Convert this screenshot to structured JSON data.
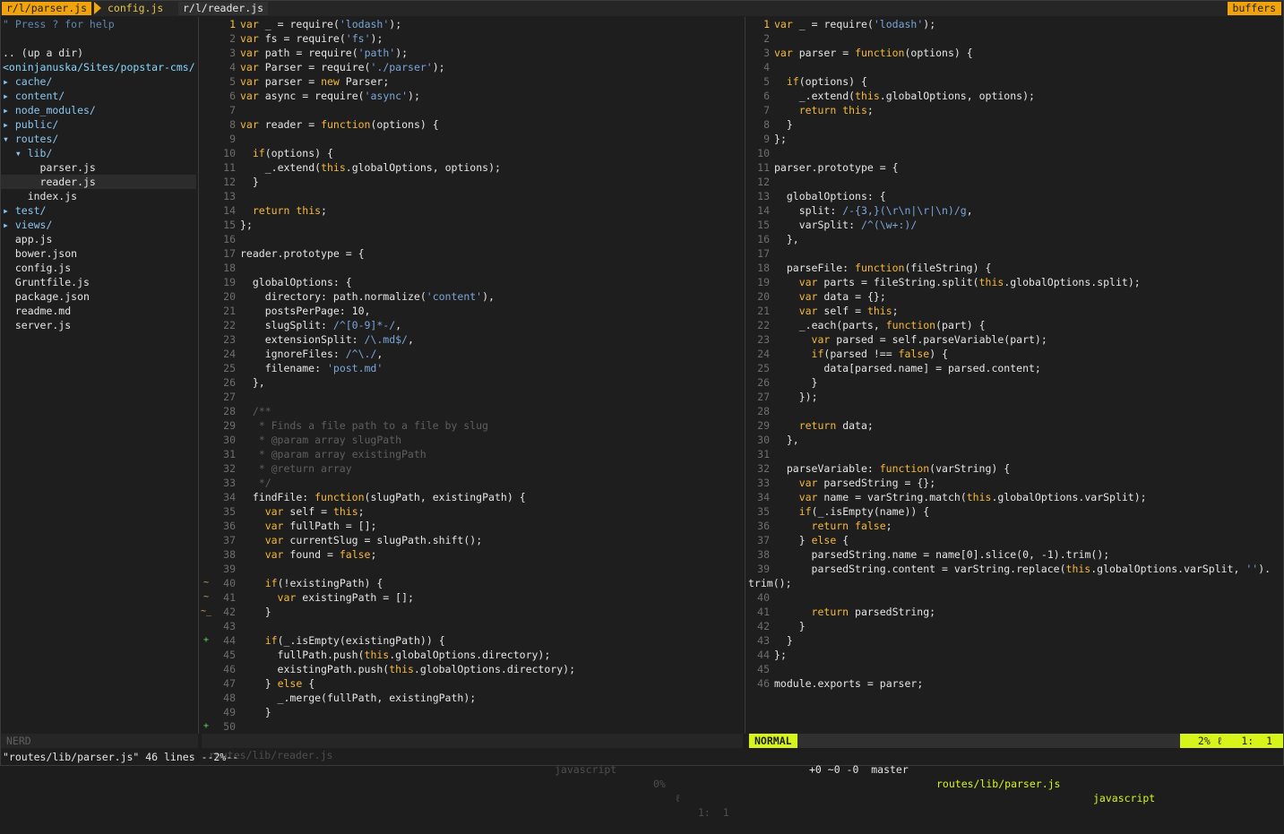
{
  "tabline": {
    "tabs": [
      "r/l/parser.js",
      "config.js",
      "r/l/reader.js"
    ],
    "buffers_label": "buffers"
  },
  "tree": {
    "lines": [
      {
        "text": "\" Press ? for help",
        "kind": "comment"
      },
      {
        "text": "",
        "kind": "blank"
      },
      {
        "text": ".. (up a dir)",
        "kind": "file"
      },
      {
        "text": "<oninjanuska/Sites/popstar-cms/",
        "kind": "root"
      },
      {
        "text": "▸ cache/",
        "kind": "dir"
      },
      {
        "text": "▸ content/",
        "kind": "dir"
      },
      {
        "text": "▸ node_modules/",
        "kind": "dir"
      },
      {
        "text": "▸ public/",
        "kind": "dir"
      },
      {
        "text": "▾ routes/",
        "kind": "dir"
      },
      {
        "text": "  ▾ lib/",
        "kind": "dir"
      },
      {
        "text": "      parser.js",
        "kind": "file"
      },
      {
        "text": "      reader.js",
        "kind": "file-hi"
      },
      {
        "text": "    index.js",
        "kind": "file"
      },
      {
        "text": "▸ test/",
        "kind": "dir"
      },
      {
        "text": "▸ views/",
        "kind": "dir"
      },
      {
        "text": "  app.js",
        "kind": "file"
      },
      {
        "text": "  bower.json",
        "kind": "file"
      },
      {
        "text": "  config.js",
        "kind": "file"
      },
      {
        "text": "  Gruntfile.js",
        "kind": "file"
      },
      {
        "text": "  package.json",
        "kind": "file"
      },
      {
        "text": "  readme.md",
        "kind": "file"
      },
      {
        "text": "  server.js",
        "kind": "file"
      }
    ]
  },
  "git_gutter": [
    {
      "line": 40,
      "mark": "~"
    },
    {
      "line": 41,
      "mark": "~"
    },
    {
      "line": 42,
      "mark": "~_"
    },
    {
      "line": 44,
      "mark": "+"
    },
    {
      "line": 50,
      "mark": "+"
    }
  ],
  "editor_left": {
    "lines": [
      "var _ = require('lodash');",
      "var fs = require('fs');",
      "var path = require('path');",
      "var Parser = require('./parser');",
      "var parser = new Parser;",
      "var async = require('async');",
      "",
      "var reader = function(options) {",
      "",
      "  if(options) {",
      "    _.extend(this.globalOptions, options);",
      "  }",
      "",
      "  return this;",
      "};",
      "",
      "reader.prototype = {",
      "",
      "  globalOptions: {",
      "    directory: path.normalize('content'),",
      "    postsPerPage: 10,",
      "    slugSplit: /^[0-9]*-/,",
      "    extensionSplit: /\\.md$/,",
      "    ignoreFiles: /^\\./,",
      "    filename: 'post.md'",
      "  },",
      "",
      "  /**",
      "   * Finds a file path to a file by slug",
      "   * @param array slugPath",
      "   * @param array existingPath",
      "   * @return array",
      "   */",
      "  findFile: function(slugPath, existingPath) {",
      "    var self = this;",
      "    var fullPath = [];",
      "    var currentSlug = slugPath.shift();",
      "    var found = false;",
      "",
      "    if(!existingPath) {",
      "      var existingPath = [];",
      "    }",
      "",
      "    if(_.isEmpty(existingPath)) {",
      "      fullPath.push(this.globalOptions.directory);",
      "      existingPath.push(this.globalOptions.directory);",
      "    } else {",
      "      _.merge(fullPath, existingPath);",
      "    }",
      ""
    ]
  },
  "editor_right": {
    "lines": [
      {
        "n": "1",
        "t": "var _ = require('lodash');"
      },
      {
        "n": "2",
        "t": ""
      },
      {
        "n": "3",
        "t": "var parser = function(options) {"
      },
      {
        "n": "4",
        "t": ""
      },
      {
        "n": "5",
        "t": "  if(options) {"
      },
      {
        "n": "6",
        "t": "    _.extend(this.globalOptions, options);"
      },
      {
        "n": "7",
        "t": "    return this;"
      },
      {
        "n": "8",
        "t": "  }"
      },
      {
        "n": "9",
        "t": "};"
      },
      {
        "n": "10",
        "t": ""
      },
      {
        "n": "11",
        "t": "parser.prototype = {"
      },
      {
        "n": "12",
        "t": ""
      },
      {
        "n": "13",
        "t": "  globalOptions: {"
      },
      {
        "n": "14",
        "t": "    split: /-{3,}(\\r\\n|\\r|\\n)/g,"
      },
      {
        "n": "15",
        "t": "    varSplit: /^(\\w+:)/"
      },
      {
        "n": "16",
        "t": "  },"
      },
      {
        "n": "17",
        "t": ""
      },
      {
        "n": "18",
        "t": "  parseFile: function(fileString) {"
      },
      {
        "n": "19",
        "t": "    var parts = fileString.split(this.globalOptions.split);"
      },
      {
        "n": "20",
        "t": "    var data = {};"
      },
      {
        "n": "21",
        "t": "    var self = this;"
      },
      {
        "n": "22",
        "t": "    _.each(parts, function(part) {"
      },
      {
        "n": "23",
        "t": "      var parsed = self.parseVariable(part);"
      },
      {
        "n": "24",
        "t": "      if(parsed !== false) {"
      },
      {
        "n": "25",
        "t": "        data[parsed.name] = parsed.content;"
      },
      {
        "n": "26",
        "t": "      }"
      },
      {
        "n": "27",
        "t": "    });"
      },
      {
        "n": "28",
        "t": ""
      },
      {
        "n": "29",
        "t": "    return data;"
      },
      {
        "n": "30",
        "t": "  },"
      },
      {
        "n": "31",
        "t": ""
      },
      {
        "n": "32",
        "t": "  parseVariable: function(varString) {"
      },
      {
        "n": "33",
        "t": "    var parsedString = {};"
      },
      {
        "n": "34",
        "t": "    var name = varString.match(this.globalOptions.varSplit);"
      },
      {
        "n": "35",
        "t": "    if(_.isEmpty(name)) {"
      },
      {
        "n": "36",
        "t": "      return false;"
      },
      {
        "n": "37",
        "t": "    } else {"
      },
      {
        "n": "38",
        "t": "      parsedString.name = name[0].slice(0, -1).trim();"
      },
      {
        "n": "39",
        "t": "      parsedString.content = varString.replace(this.globalOptions.varSplit, '')."
      },
      {
        "n": "",
        "t": "trim();"
      },
      {
        "n": "40",
        "t": ""
      },
      {
        "n": "41",
        "t": "      return parsedString;"
      },
      {
        "n": "42",
        "t": "    }"
      },
      {
        "n": "43",
        "t": "  }"
      },
      {
        "n": "44",
        "t": "};"
      },
      {
        "n": "45",
        "t": ""
      },
      {
        "n": "46",
        "t": "module.exports = parser;"
      }
    ]
  },
  "status": {
    "tree_label": "NERD",
    "left_file": "routes/lib/reader.js",
    "left_type": "javascript",
    "left_pct": "0%",
    "left_pos": "1:  1",
    "mode": "NORMAL",
    "git": "+0 ~0 -0  master",
    "right_file": "routes/lib/parser.js",
    "right_type": "javascript",
    "right_pct": "2%",
    "right_pos": "1:  1"
  },
  "message": "\"routes/lib/parser.js\" 46 lines --2%--"
}
